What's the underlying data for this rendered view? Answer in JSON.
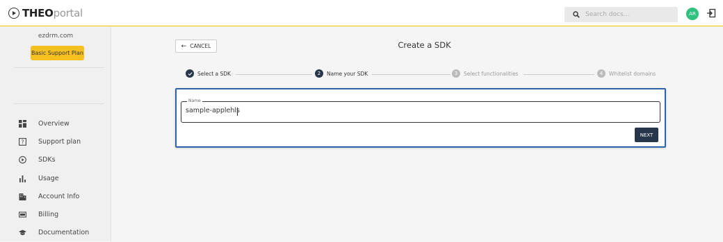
{
  "header": {
    "logo_bold": "THEO",
    "logo_light": "portal",
    "search_placeholder": "Search docs...",
    "avatar_initials": "AR"
  },
  "sidebar": {
    "org_name": "ezdrm.com",
    "plan_label": "Basic Support Plan",
    "items": [
      {
        "label": "Overview",
        "icon": "grid-icon"
      },
      {
        "label": "Support plan",
        "icon": "question-square-icon"
      },
      {
        "label": "SDKs",
        "icon": "play-circle-icon"
      },
      {
        "label": "Usage",
        "icon": "bar-chart-icon"
      },
      {
        "label": "Account Info",
        "icon": "building-icon"
      },
      {
        "label": "Billing",
        "icon": "bill-icon"
      },
      {
        "label": "Documentation",
        "icon": "graduation-cap-icon"
      }
    ]
  },
  "main": {
    "cancel_label": "CANCEL",
    "page_title": "Create a SDK",
    "steps": [
      {
        "number": "1",
        "label": "Select a SDK",
        "state": "completed"
      },
      {
        "number": "2",
        "label": "Name your SDK",
        "state": "active"
      },
      {
        "number": "3",
        "label": "Select functionalities",
        "state": "pending"
      },
      {
        "number": "4",
        "label": "Whitelist domains",
        "state": "pending"
      }
    ],
    "name_field_label": "Name",
    "name_field_value": "sample-applehls",
    "next_label": "NEXT"
  },
  "colors": {
    "accent_yellow": "#f6c120",
    "primary_dark": "#27364a",
    "focus_blue": "#2b62a8",
    "avatar_green": "#2ec27e"
  }
}
